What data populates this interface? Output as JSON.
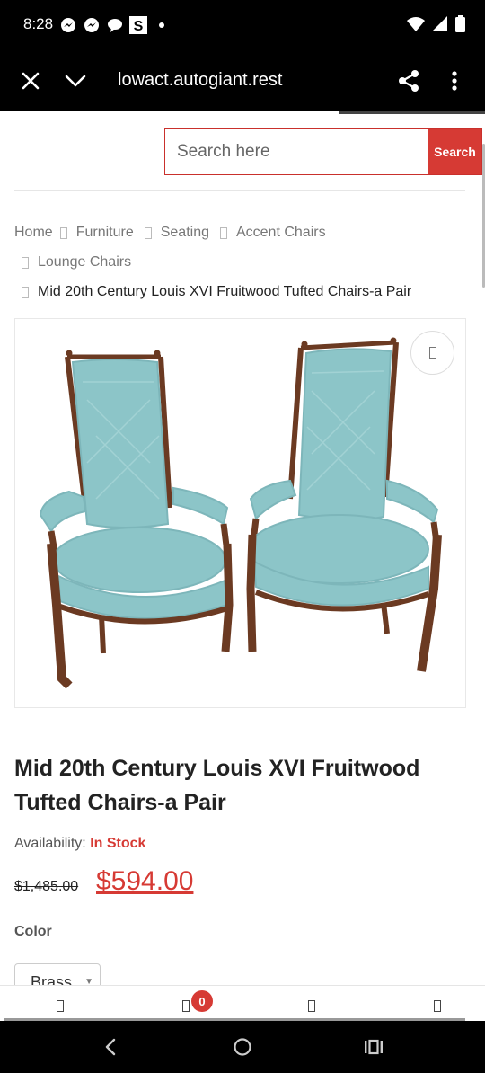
{
  "status_bar": {
    "time": "8:28",
    "left_icons": [
      "messenger-icon",
      "messenger-icon",
      "chat-bubble-icon",
      "s-app-icon",
      "dot-icon"
    ],
    "s_app_letter": "S",
    "right_icons": [
      "wifi-icon",
      "signal-icon",
      "battery-icon"
    ]
  },
  "browser": {
    "url": "lowact.autogiant.rest"
  },
  "search": {
    "placeholder": "Search here",
    "button_label": "Search"
  },
  "breadcrumb": {
    "items": [
      "Home",
      "Furniture",
      "Seating",
      "Accent Chairs",
      "Lounge Chairs"
    ],
    "current": "Mid 20th Century Louis XVI Fruitwood Tufted Chairs-a Pair"
  },
  "product": {
    "image_alt": "Pair of Louis XVI fruitwood tufted chairs with light blue upholstery",
    "title": "Mid 20th Century Louis XVI Fruitwood Tufted Chairs-a Pair",
    "availability_label": "Availability:",
    "availability_value": "In Stock",
    "old_price": "$1,485.00",
    "new_price": "$594.00",
    "color_label": "Color",
    "color_selected": "Brass"
  },
  "bottom_nav": {
    "cart_count": "0",
    "icons": [
      "home-icon",
      "cart-icon",
      "account-icon",
      "menu-icon"
    ]
  },
  "colors": {
    "accent": "#d63a34",
    "upholstery": "#8cc5c8",
    "wood": "#6b3a22"
  }
}
